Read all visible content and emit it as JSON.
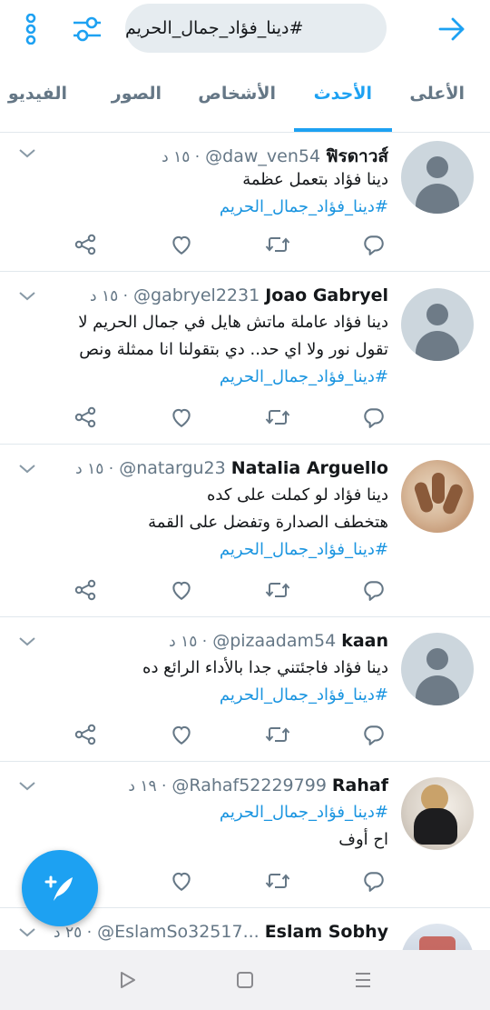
{
  "search": {
    "query": "#دينا_فؤاد_جمال_الحريم"
  },
  "tabs": [
    {
      "label": "الأعلى"
    },
    {
      "label": "الأحدث"
    },
    {
      "label": "الأشخاص"
    },
    {
      "label": "الصور"
    },
    {
      "label": "الفيديو"
    }
  ],
  "active_tab": "الأحدث",
  "tweets": [
    {
      "name": "ฟิรดาวส์",
      "handle": "@daw_ven54",
      "time": "١٥ د ·",
      "lines": [
        "دينا فؤاد بتعمل عظمة"
      ],
      "hashtag": "#دينا_فؤاد_جمال_الحريم"
    },
    {
      "name": "Joao Gabryel",
      "handle": "@gabryel2231",
      "time": "١٥ د ·",
      "lines": [
        "دينا فؤاد عاملة ماتش هايل في جمال الحريم لا",
        "تقول نور ولا اي حد.. دي بتقولنا انا ممثلة ونص"
      ],
      "hashtag": "#دينا_فؤاد_جمال_الحريم"
    },
    {
      "name": "Natalia Arguello",
      "handle": "@natargu23",
      "time": "١٥ د ·",
      "lines": [
        "دينا فؤاد لو كملت على كده",
        "هتخطف الصدارة وتفضل على القمة"
      ],
      "hashtag": "#دينا_فؤاد_جمال_الحريم"
    },
    {
      "name": "kaan",
      "handle": "@pizaadam54",
      "time": "١٥ د ·",
      "lines": [
        "دينا فؤاد فاجئتني جدا بالأداء الرائع ده"
      ],
      "hashtag": "#دينا_فؤاد_جمال_الحريم"
    },
    {
      "name": "Rahaf",
      "handle": "@Rahaf52229799",
      "time": "١٩ د ·",
      "hashtag": "#دينا_فؤاد_جمال_الحريم",
      "lines": [
        "اح أوف"
      ]
    },
    {
      "name": "Eslam Sobhy",
      "handle": "@EslamSo32517...",
      "time": "٢٥ د ·"
    }
  ],
  "colors": {
    "accent": "#1da1f2",
    "link": "#1b95e0",
    "muted": "#657786"
  }
}
